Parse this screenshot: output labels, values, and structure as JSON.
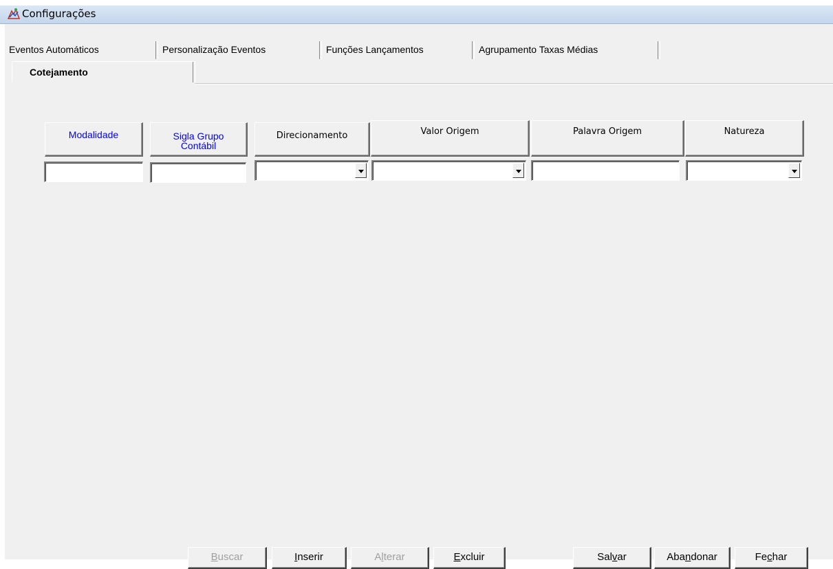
{
  "window": {
    "title": "Configurações"
  },
  "tabs_row1": [
    {
      "label": "Eventos Automáticos"
    },
    {
      "label": "Personalização Eventos"
    },
    {
      "label": "Funções Lançamentos"
    },
    {
      "label": "Agrupamento Taxas Médias"
    }
  ],
  "tabs_row2": [
    {
      "label": "Cotejamento",
      "active": true
    }
  ],
  "columns": [
    {
      "label": "Modalidade",
      "color": "#0000ff",
      "type": "text",
      "value": ""
    },
    {
      "label_line1": "Sigla Grupo",
      "label_line2": "Contábil",
      "color": "#0000ff",
      "type": "text",
      "value": ""
    },
    {
      "label": "Direcionamento",
      "color": "#000000",
      "type": "select",
      "value": ""
    },
    {
      "label": "Valor Origem",
      "color": "#000000",
      "type": "select",
      "value": ""
    },
    {
      "label": "Palavra Origem",
      "color": "#000000",
      "type": "text",
      "value": ""
    },
    {
      "label": "Natureza",
      "color": "#000000",
      "type": "select",
      "value": ""
    }
  ],
  "buttons": {
    "buscar": {
      "pre": "",
      "key": "B",
      "post": "uscar",
      "enabled": false
    },
    "inserir": {
      "pre": "",
      "key": "I",
      "post": "nserir",
      "enabled": true
    },
    "alterar": {
      "pre": "A",
      "key": "l",
      "post": "terar",
      "enabled": false
    },
    "excluir": {
      "pre": "",
      "key": "E",
      "post": "xcluir",
      "enabled": true
    },
    "salvar": {
      "pre": "Sal",
      "key": "v",
      "post": "ar",
      "enabled": true
    },
    "abandonar": {
      "pre": "Aba",
      "key": "n",
      "post": "donar",
      "enabled": true
    },
    "fechar": {
      "pre": "Fe",
      "key": "c",
      "post": "har",
      "enabled": true
    }
  }
}
